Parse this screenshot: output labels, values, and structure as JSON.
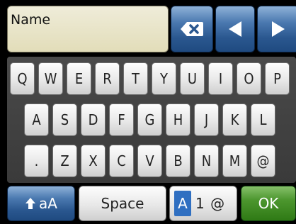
{
  "input": {
    "placeholder": "Name"
  },
  "controls": {
    "backspace_icon": "backspace-icon",
    "left_icon": "arrow-left-icon",
    "right_icon": "arrow-right-icon"
  },
  "keyboard": {
    "row1": [
      "Q",
      "W",
      "E",
      "R",
      "T",
      "Y",
      "U",
      "I",
      "O",
      "P"
    ],
    "row2": [
      "A",
      "S",
      "D",
      "F",
      "G",
      "H",
      "J",
      "K",
      "L"
    ],
    "row3": [
      ".",
      "Z",
      "X",
      "C",
      "V",
      "B",
      "N",
      "M",
      "@"
    ]
  },
  "bottom": {
    "shift_label": "aA",
    "shift_icon": "shift-up-icon",
    "space_label": "Space",
    "mode_active": "A",
    "mode_rest": "1 @",
    "ok_label": "OK"
  },
  "colors": {
    "accent_blue": "#2a578f",
    "ok_green": "#4c962e",
    "field_bg": "#e9e5c9"
  }
}
